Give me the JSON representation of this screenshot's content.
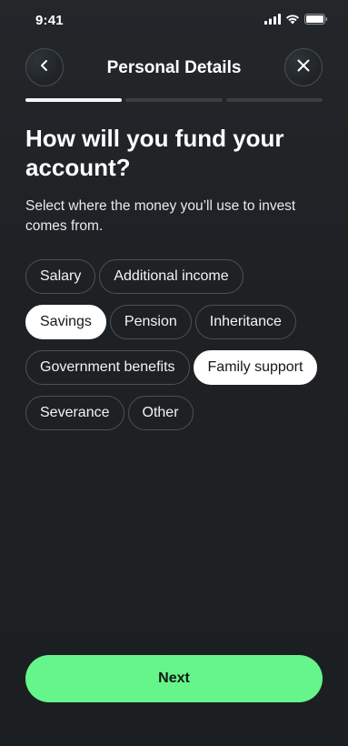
{
  "status_bar": {
    "time": "9:41"
  },
  "header": {
    "title": "Personal Details",
    "back_icon": "chevron-left-icon",
    "close_icon": "close-icon"
  },
  "progress": {
    "total_steps": 3,
    "current_step": 1
  },
  "question": {
    "title": "How will you fund your account?",
    "subtitle": "Select where the money you’ll use to invest comes from."
  },
  "options": [
    {
      "label": "Salary",
      "selected": false
    },
    {
      "label": "Additional income",
      "selected": false
    },
    {
      "label": "Savings",
      "selected": true
    },
    {
      "label": "Pension",
      "selected": false
    },
    {
      "label": "Inheritance",
      "selected": false
    },
    {
      "label": "Government benefits",
      "selected": false
    },
    {
      "label": "Family support",
      "selected": true
    },
    {
      "label": "Severance",
      "selected": false
    },
    {
      "label": "Other",
      "selected": false
    }
  ],
  "next_button": {
    "label": "Next"
  },
  "colors": {
    "background": "#1f2326",
    "accent": "#66f58a",
    "chip_selected_bg": "#ffffff",
    "chip_border": "#4c5156"
  }
}
